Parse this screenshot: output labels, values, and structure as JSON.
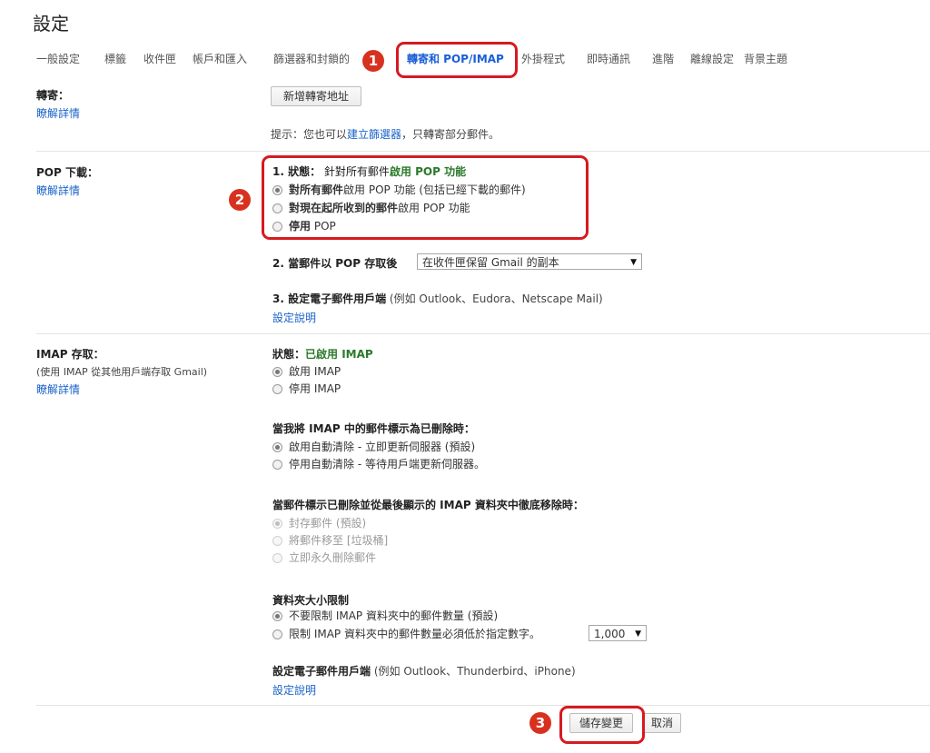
{
  "page_title": "設定",
  "tabs": [
    "一般設定",
    "標籤",
    "收件匣",
    "帳戶和匯入",
    "篩選器和封鎖的",
    "轉寄和 POP/IMAP",
    "外掛程式",
    "即時通訊",
    "進階",
    "離線設定",
    "背景主題"
  ],
  "forwarding": {
    "label": "轉寄：",
    "learn_more": "瞭解詳情",
    "add_button": "新增轉寄地址",
    "tip_prefix": "提示：您也可以",
    "tip_link": "建立篩選器",
    "tip_suffix": "，只轉寄部分郵件。"
  },
  "pop": {
    "label": "POP 下載：",
    "learn_more": "瞭解詳情",
    "status_prefix": "1. 狀態：",
    "status_desc": "針對所有郵件",
    "status_value": "啟用 POP 功能",
    "options": [
      {
        "bold": "對所有郵件",
        "rest": "啟用 POP 功能 (包括已經下載的郵件)",
        "selected": true
      },
      {
        "bold": "對現在起所收到的郵件",
        "rest": "啟用 POP 功能",
        "selected": false
      },
      {
        "bold": "停用",
        "rest": " POP",
        "selected": false
      }
    ],
    "step2_label": "2. 當郵件以 POP 存取後",
    "step2_value": "在收件匣保留 Gmail 的副本",
    "step3_label": "3. 設定電子郵件用戶端",
    "step3_desc": "(例如 Outlook、Eudora、Netscape Mail)",
    "step3_link": "設定說明"
  },
  "imap": {
    "label": "IMAP 存取：",
    "sublabel": "(使用 IMAP 從其他用戶端存取 Gmail)",
    "learn_more": "瞭解詳情",
    "status_prefix": "狀態：",
    "status_value": "已啟用 IMAP",
    "status_options": [
      "啟用 IMAP",
      "停用 IMAP"
    ],
    "delete_heading": "當我將 IMAP 中的郵件標示為已刪除時：",
    "delete_options": [
      "啟用自動清除 - 立即更新伺服器 (預設)",
      "停用自動清除 - 等待用戶端更新伺服器。"
    ],
    "expunge_heading": "當郵件標示已刪除並從最後顯示的 IMAP 資料夾中徹底移除時：",
    "expunge_options": [
      "封存郵件 (預設)",
      "將郵件移至 [垃圾桶]",
      "立即永久刪除郵件"
    ],
    "folder_heading": "資料夾大小限制",
    "folder_options": [
      "不要限制 IMAP 資料夾中的郵件數量 (預設)",
      "限制 IMAP 資料夾中的郵件數量必須低於指定數字。"
    ],
    "folder_limit_value": "1,000",
    "client_label": "設定電子郵件用戶端",
    "client_desc": "(例如 Outlook、Thunderbird、iPhone)",
    "client_link": "設定說明"
  },
  "footer": {
    "save_label": "儲存變更",
    "cancel_label": "取消"
  },
  "annotations": [
    "1",
    "2",
    "3"
  ],
  "colors": {
    "accent": "#1a5fd6",
    "annotation": "#d71920",
    "enabled_green": "#2a7a2a"
  }
}
